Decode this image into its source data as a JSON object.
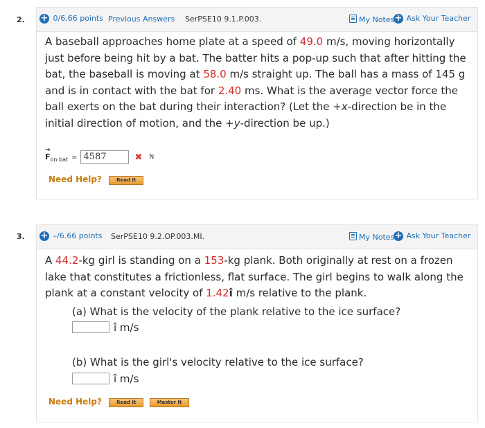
{
  "q2": {
    "number": "2.",
    "points": "0/6.66 points",
    "previous_answers": "Previous Answers",
    "code": "SerPSE10 9.1.P.003.",
    "my_notes": "My Notes",
    "ask_teacher": "Ask Your Teacher",
    "text": {
      "t1": "A baseball approaches home plate at a speed of ",
      "v1": "49.0",
      "t2": " m/s, moving horizontally just before being hit by a bat. The batter hits a pop-up such that after hitting the bat, the baseball is moving at ",
      "v2": "58.0",
      "t3": " m/s straight up. The ball has a mass of 145 g and is in contact with the bat for ",
      "v3": "2.40",
      "t4": " ms. What is the average vector force the ball exerts on the bat during their interaction? (Let the +",
      "x": "x",
      "t5": "-direction be in the initial direction of motion, and the +",
      "y": "y",
      "t6": "-direction be up.)"
    },
    "answer_label": "F",
    "answer_sub": "on bat",
    "equals": "=",
    "answer_value": "4587",
    "wrong_mark": "✖",
    "unit": "N",
    "need_help": "Need Help?",
    "read_it": "Read It"
  },
  "q3": {
    "number": "3.",
    "points": "–/6.66 points",
    "code": "SerPSE10 9.2.OP.003.MI.",
    "my_notes": "My Notes",
    "ask_teacher": "Ask Your Teacher",
    "text": {
      "t1": "A ",
      "v1": "44.2",
      "t2": "-kg girl is standing on a ",
      "v2": "153",
      "t3": "-kg plank. Both originally at rest on a frozen lake that constitutes a frictionless, flat surface. The girl begins to walk along the plank at a constant velocity of ",
      "v3": "1.42",
      "t3b": "î",
      "t4": " m/s relative to the plank."
    },
    "part_a": "(a) What is the velocity of the plank relative to the ice surface?",
    "part_a_unit": "î m/s",
    "part_b": "(b) What is the girl's velocity relative to the ice surface?",
    "part_b_unit": "î m/s",
    "need_help": "Need Help?",
    "read_it": "Read It",
    "master_it": "Master It"
  }
}
